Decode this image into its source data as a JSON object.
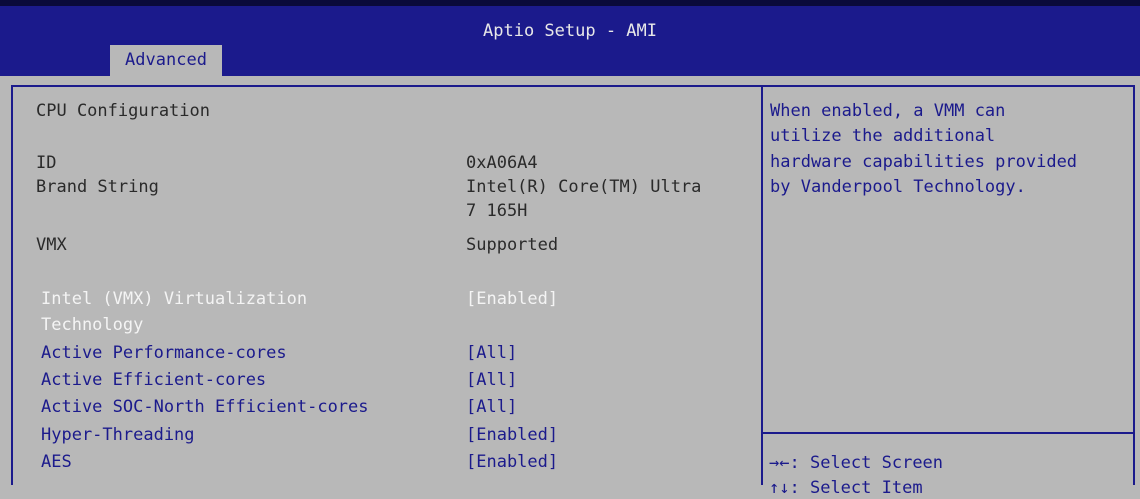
{
  "window": {
    "title": "Aptio Setup - AMI"
  },
  "tabs": [
    {
      "label": "Advanced"
    }
  ],
  "section": {
    "title": "CPU Configuration"
  },
  "info": [
    {
      "label": "ID",
      "value": "0xA06A4"
    },
    {
      "label": "Brand String",
      "value": "Intel(R) Core(TM) Ultra",
      "value_line2": "7 165H"
    },
    {
      "label": "VMX",
      "value": "Supported"
    }
  ],
  "settings": [
    {
      "label": "Intel (VMX) Virtualization",
      "label_line2": "Technology",
      "value": "[Enabled]",
      "selected": true
    },
    {
      "label": "Active Performance-cores",
      "value": "[All]"
    },
    {
      "label": "Active Efficient-cores",
      "value": "[All]"
    },
    {
      "label": "Active SOC-North Efficient-cores",
      "value": "[All]"
    },
    {
      "label": "Hyper-Threading",
      "value": "[Enabled]"
    },
    {
      "label": "AES",
      "value": "[Enabled]"
    }
  ],
  "help": {
    "lines": [
      "When enabled, a VMM can",
      "utilize the additional",
      "hardware capabilities provided",
      "by Vanderpool Technology."
    ],
    "keys": [
      {
        "key": "→←:",
        "action": "Select Screen"
      },
      {
        "key": "↑↓:",
        "action": "Select Item"
      }
    ]
  },
  "colors": {
    "header": "#1b1a8c",
    "background": "#b8b8b8",
    "selected_text": "#f4f4f4",
    "static_text": "#2a2a2a"
  }
}
